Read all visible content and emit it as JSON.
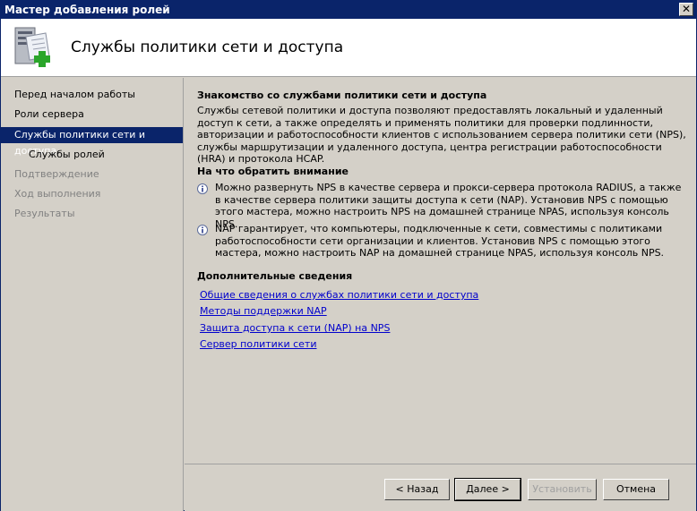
{
  "window": {
    "title": "Мастер добавления ролей",
    "close_label": "✕"
  },
  "header": {
    "title": "Службы политики сети и доступа",
    "icon": "server-add-icon"
  },
  "sidebar": {
    "items": [
      {
        "label": "Перед началом работы",
        "state": "normal"
      },
      {
        "label": "Роли сервера",
        "state": "normal"
      },
      {
        "label": "Службы политики сети и доступа",
        "state": "active"
      },
      {
        "label": "Службы ролей",
        "state": "sub"
      },
      {
        "label": "Подтверждение",
        "state": "disabled"
      },
      {
        "label": "Ход выполнения",
        "state": "disabled"
      },
      {
        "label": "Результаты",
        "state": "disabled"
      }
    ]
  },
  "main": {
    "intro_heading": "Знакомство со службами политики сети и доступа",
    "intro_text": "Службы сетевой политики и доступа позволяют предоставлять локальный и удаленный доступ к сети, а также определять и применять политики для проверки подлинности, авторизации и работоспособности клиентов с использованием сервера политики сети (NPS), службы маршрутизации и удаленного доступа, центра регистрации работоспособности (HRA) и протокола HCAP.",
    "notes_heading": "На что обратить внимание",
    "notes": [
      "Можно развернуть NPS в качестве сервера и прокси-сервера протокола RADIUS, а также в качестве сервера политики защиты доступа к сети (NAP). Установив NPS с помощью этого мастера, можно настроить NPS на домашней странице NPAS, используя консоль NPS.",
      "NAP гарантирует, что компьютеры, подключенные к сети, совместимы с политиками работоспособности сети организации и клиентов. Установив NPS с помощью этого мастера, можно настроить NAP на домашней странице NPAS, используя консоль NPS."
    ],
    "more_heading": "Дополнительные сведения",
    "links": [
      "Общие сведения о службах политики сети и доступа",
      "Методы поддержки NAP",
      "Защита доступа к сети (NAP) на NPS",
      "Сервер политики сети"
    ]
  },
  "footer": {
    "back_label": "< Назад",
    "next_label": "Далее >",
    "install_label": "Установить",
    "cancel_label": "Отмена"
  }
}
